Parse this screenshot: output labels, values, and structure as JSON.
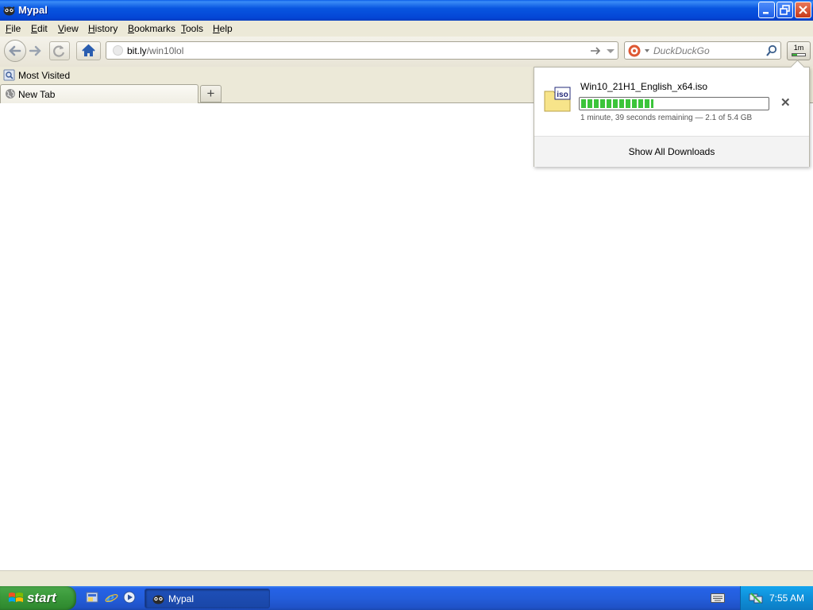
{
  "window": {
    "title": "Mypal"
  },
  "menu": [
    {
      "label": "File",
      "accel": "F",
      "rest": "ile"
    },
    {
      "label": "Edit",
      "accel": "E",
      "rest": "dit"
    },
    {
      "label": "View",
      "accel": "V",
      "rest": "iew"
    },
    {
      "label": "History",
      "accel": "H",
      "rest": "istory"
    },
    {
      "label": "Bookmarks",
      "accel": "B",
      "rest": "ookmarks"
    },
    {
      "label": "Tools",
      "accel": "T",
      "rest": "ools"
    },
    {
      "label": "Help",
      "accel": "H",
      "rest": "elp"
    }
  ],
  "address_bar": {
    "host": "bit.ly",
    "path": "/win10lol"
  },
  "search_bar": {
    "placeholder": "DuckDuckGo"
  },
  "downloads_button": {
    "label": "1m",
    "progress": 0.39
  },
  "bookmarks_bar": {
    "items": [
      {
        "label": "Most Visited"
      }
    ]
  },
  "tabs": [
    {
      "label": "New Tab",
      "selected": true
    }
  ],
  "downloads_panel": {
    "file_name": "Win10_21H1_English_x64.iso",
    "file_type": "iso",
    "progress": 0.39,
    "status": "1 minute, 39 seconds remaining — 2.1 of 5.4 GB",
    "show_all": "Show All Downloads"
  },
  "taskbar": {
    "start_label": "start",
    "tasks": [
      {
        "label": "Mypal"
      }
    ],
    "clock": "7:55 AM"
  },
  "colors": {
    "title_bar": "#0446d6",
    "taskbar": "#245edb",
    "start_button": "#3c9b3c",
    "progress_fill": "#3bc43a"
  }
}
